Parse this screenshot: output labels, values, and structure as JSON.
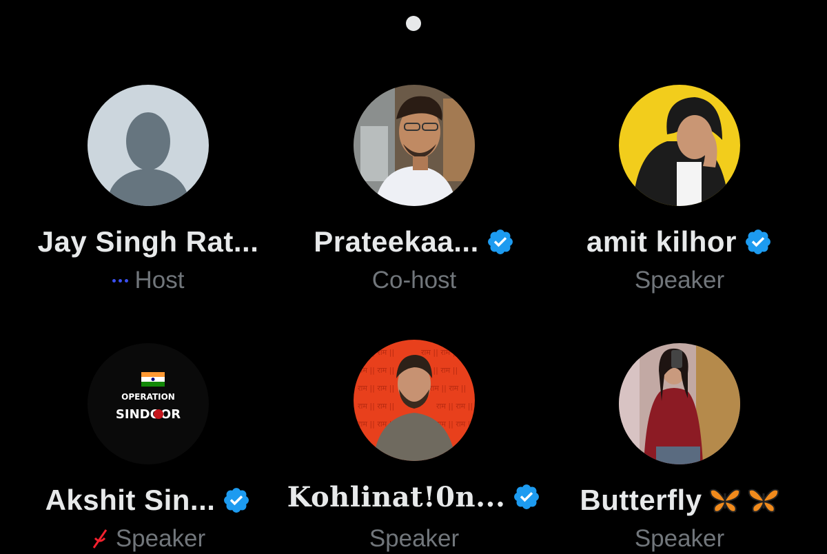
{
  "speakers": [
    {
      "name": "Jay Singh Rat...",
      "role": "Host",
      "verified": false,
      "avatar": "default-avatar-icon"
    },
    {
      "name": "Prateekaa...",
      "role": "Co-host",
      "verified": true,
      "avatar": "profile-photo-man-smiling"
    },
    {
      "name": "amit kilhor",
      "role": "Speaker",
      "verified": true,
      "avatar": "profile-photo-man-hoodie-yellow"
    },
    {
      "name": "Akshit Sin...",
      "role": "Speaker",
      "verified": true,
      "avatar": "operation-sindoor-logo",
      "avatar_text": {
        "line1": "OPERATION",
        "line2": "SINDOOR"
      }
    },
    {
      "name": "Kohlinat!0n...",
      "role": "Speaker",
      "verified": true,
      "avatar": "profile-photo-man-red-background",
      "avatar_text": {
        "pattern": "राम || राम ||"
      }
    },
    {
      "name": "Butterfly",
      "role": "Speaker",
      "verified": false,
      "avatar": "profile-photo-woman-mirror-selfie"
    }
  ],
  "colors": {
    "background": "#000000",
    "name_text": "#e7e9ea",
    "role_text": "#71767b",
    "verified_badge": "#1d9bf0",
    "host_talk_indicator": "#3b50f2"
  }
}
